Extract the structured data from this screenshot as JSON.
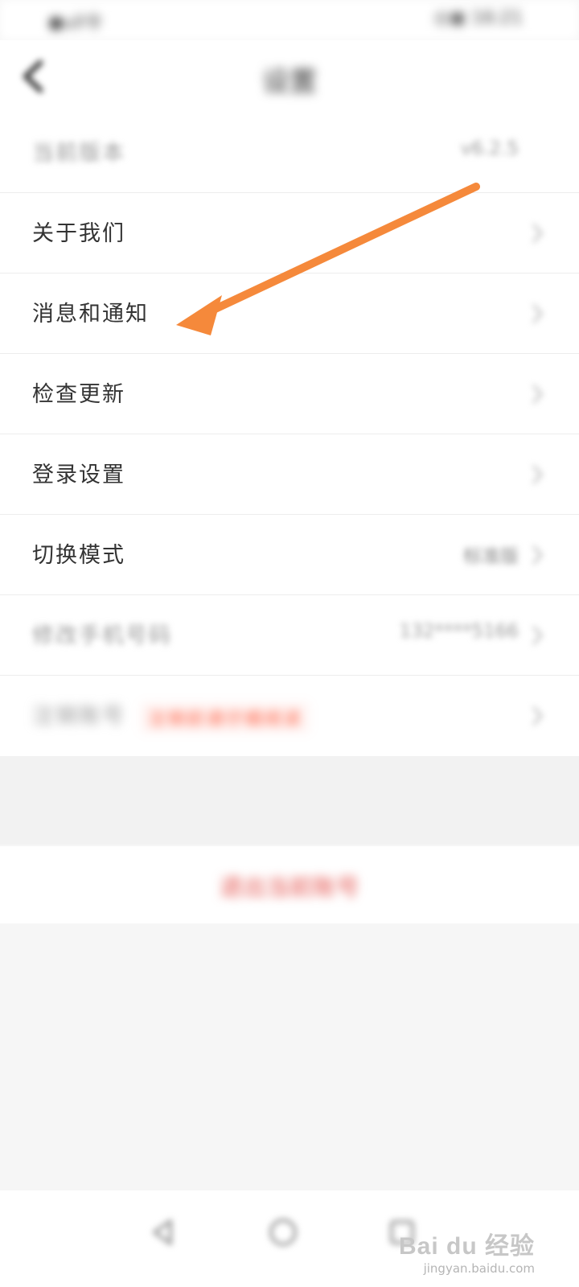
{
  "status_bar": {
    "left_text": "●ull令",
    "right_text": "◎▣ 16:21"
  },
  "header": {
    "title": "设置",
    "back_icon": "chevron-left-icon"
  },
  "settings": [
    {
      "label": "当前版本",
      "value": "v6.2.5",
      "dim": true,
      "has_chevron": false
    },
    {
      "label": "关于我们",
      "value": "",
      "dim": false,
      "has_chevron": true
    },
    {
      "label": "消息和通知",
      "value": "",
      "dim": false,
      "has_chevron": true
    },
    {
      "label": "检查更新",
      "value": "",
      "dim": false,
      "has_chevron": true
    },
    {
      "label": "登录设置",
      "value": "",
      "dim": false,
      "has_chevron": true
    },
    {
      "label": "切换模式",
      "value": "标准版",
      "dim": false,
      "has_chevron": true
    },
    {
      "label": "修改手机号码",
      "value": "132****5166",
      "dim": true,
      "has_chevron": true
    },
    {
      "label": "注销账号",
      "value": "",
      "dim": true,
      "has_chevron": true,
      "badge": "注销前请仔细阅读"
    }
  ],
  "logout": {
    "label": "退出当前账号"
  },
  "nav": {
    "back_icon": "nav-back-icon",
    "home_icon": "nav-home-icon",
    "recent_icon": "nav-recent-icon"
  },
  "watermark": {
    "logo": "Bai du 经验",
    "url": "jingyan.baidu.com"
  },
  "colors": {
    "arrow": "#f5893b",
    "logout_text": "#e45550",
    "badge_text": "#ff5a3c"
  }
}
